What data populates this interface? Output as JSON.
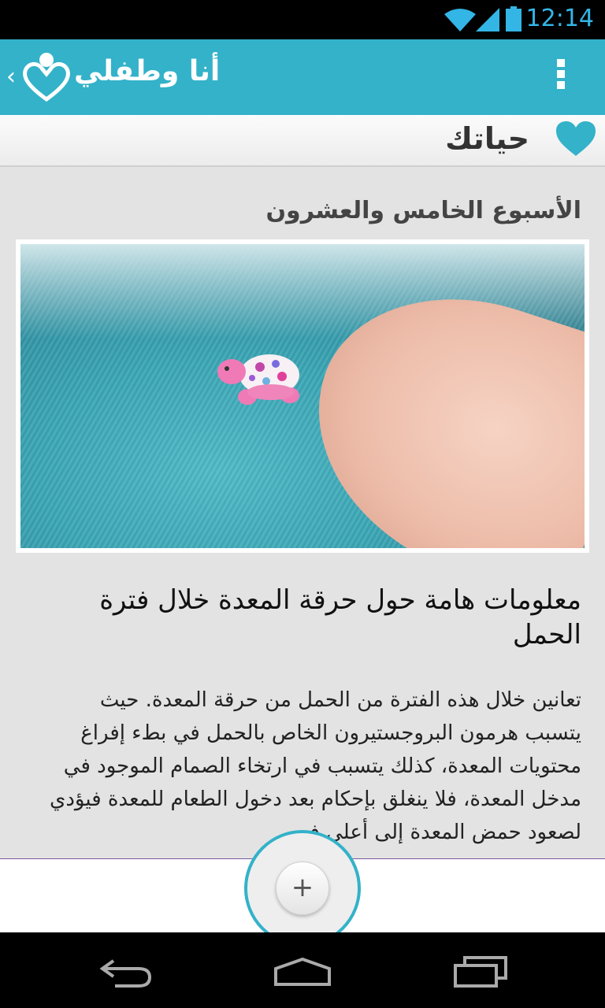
{
  "status_bar": {
    "time": "12:14"
  },
  "app_bar": {
    "title": "أنا وطفلي",
    "back_glyph": "‹",
    "menu_icon": "overflow-menu-icon",
    "logo_icon": "heart-baby-logo-icon"
  },
  "section": {
    "label": "حياتك",
    "icon": "heart-icon",
    "accent": "#33b2c9"
  },
  "content": {
    "week_label": "الأسبوع الخامس والعشرون",
    "article_title": "معلومات هامة حول حرقة المعدة خلال فترة الحمل",
    "article_body": "تعانين خلال هذه الفترة من الحمل من حرقة المعدة. حيث يتسبب هرمون البروجستيرون الخاص بالحمل في بطء إفراغ محتويات المعدة، كذلك يتسبب في ارتخاء الصمام الموجود في مدخل المعدة، فلا ينغلق بإحكام بعد دخول الطعام للمعدة فيؤدي لصعود حمض المعدة إلى أعلى في"
  },
  "fab": {
    "label": "+"
  },
  "colors": {
    "brand": "#33b2c9",
    "statusbar_accent": "#33b5e5"
  }
}
